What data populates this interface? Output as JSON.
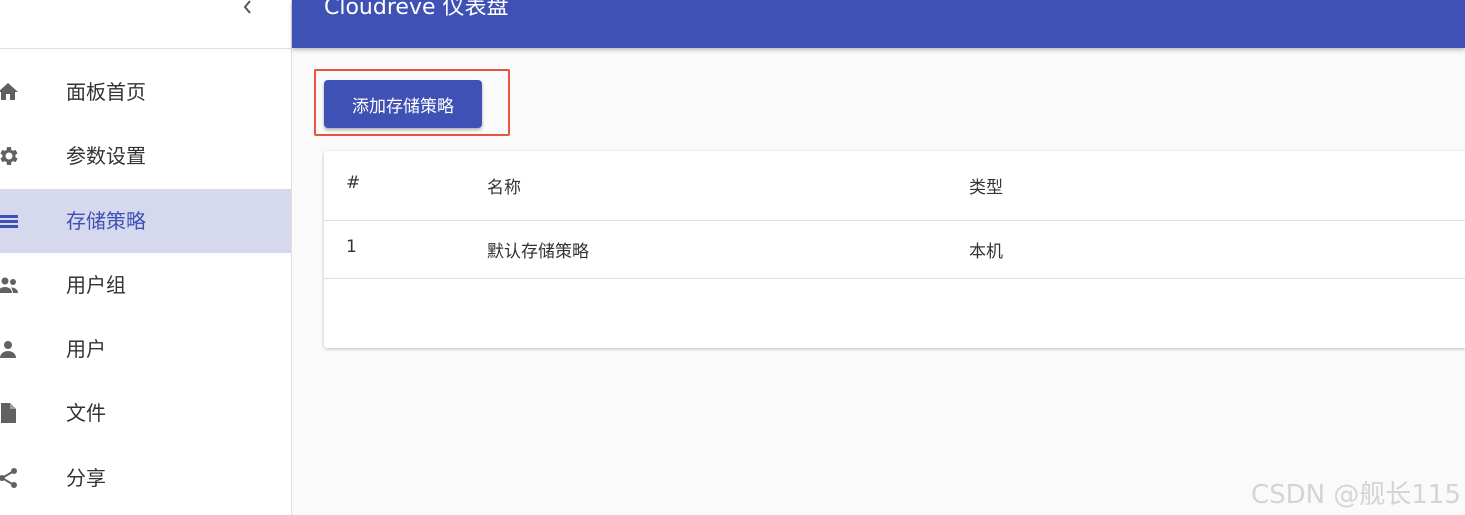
{
  "app": {
    "title": "Cloudreve 仪表盘",
    "accent_color": "#3f51b5"
  },
  "sidebar": {
    "collapse_icon": "chevron-left-icon",
    "items": [
      {
        "label": "面板首页",
        "icon": "home-icon",
        "active": false
      },
      {
        "label": "参数设置",
        "icon": "gear-icon",
        "active": false
      },
      {
        "label": "存储策略",
        "icon": "list-icon",
        "active": true
      },
      {
        "label": "用户组",
        "icon": "people-icon",
        "active": false
      },
      {
        "label": "用户",
        "icon": "person-icon",
        "active": false
      },
      {
        "label": "文件",
        "icon": "file-icon",
        "active": false
      },
      {
        "label": "分享",
        "icon": "share-icon",
        "active": false
      }
    ]
  },
  "main": {
    "add_button_label": "添加存储策略",
    "table": {
      "columns": [
        "#",
        "名称",
        "类型"
      ],
      "rows": [
        [
          "1",
          "默认存储策略",
          "本机"
        ]
      ]
    }
  },
  "watermark": "CSDN @舰长115"
}
